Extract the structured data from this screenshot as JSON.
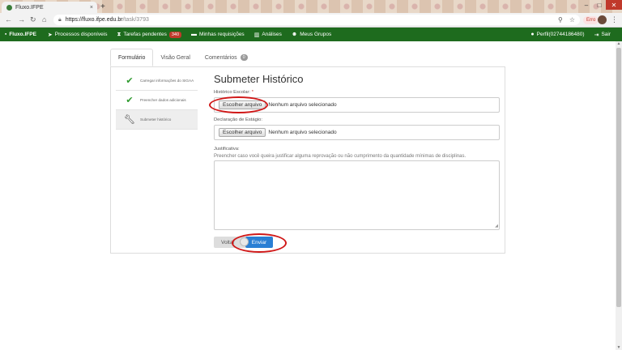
{
  "browser": {
    "tab_title": "Fluxo.IFPE",
    "tab_close": "×",
    "new_tab": "+",
    "url_host": "https://fluxo.ifpe.edu.br",
    "url_path": "/task/3793",
    "user_chip": "Erro"
  },
  "navbar": {
    "brand": "Fluxo.IFPE",
    "processos": "Processos disponíveis",
    "tarefas": "Tarefas pendentes",
    "tarefas_count": "340",
    "requisicoes": "Minhas requisições",
    "analises": "Análises",
    "grupos": "Meus Grupos",
    "perfil": "Perfil(02744186480)",
    "sair": "Sair"
  },
  "tabs": {
    "formulario": "Formulário",
    "visao_geral": "Visão Geral",
    "comentarios": "Comentários",
    "comentarios_count": "0"
  },
  "steps": [
    {
      "label": "Carregar informações do SIGAA"
    },
    {
      "label": "Preencher dados adicionais"
    },
    {
      "label": "Submeter histórico"
    }
  ],
  "form": {
    "title": "Submeter Histórico",
    "historico_label": "Histórico Escolar:",
    "required_mark": "*",
    "choose_file": "Escolher arquivo",
    "no_file": "Nenhum arquivo selecionado",
    "declaracao_label": "Declaração de Estágio:",
    "justificativa_label": "Justificativa:",
    "justificativa_hint": "Preencher caso você queira justificar alguma reprovação ou não cumprimento da quantidade mínimas de disciplinas.",
    "voltar": "Voltar",
    "enviar": "Enviar"
  },
  "colors": {
    "navbar": "#1e6b1e",
    "primary_button": "#2a7fd4",
    "badge": "#c0392b",
    "annotation": "#d01818"
  }
}
